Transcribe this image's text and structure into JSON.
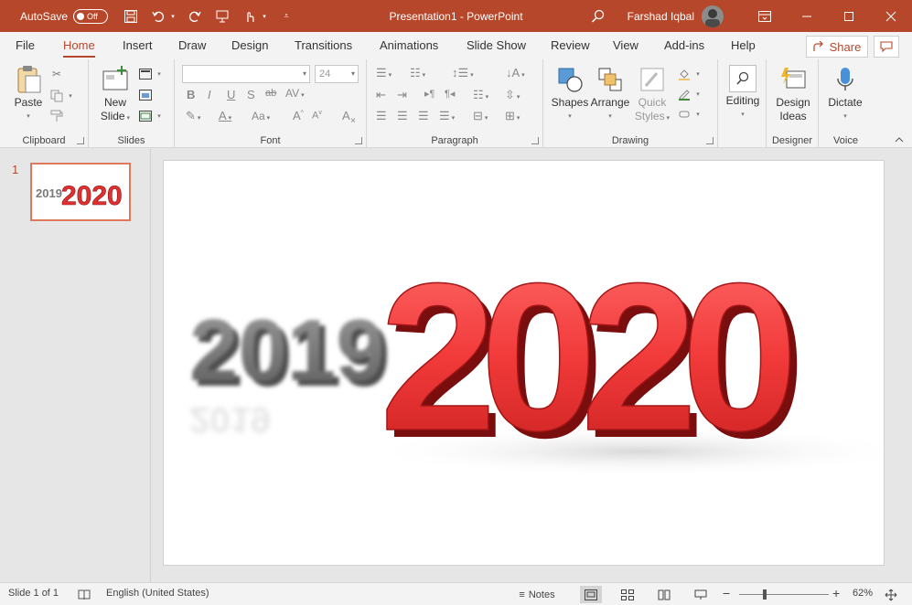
{
  "titlebar": {
    "autosave_label": "AutoSave",
    "autosave_state": "Off",
    "doc_title": "Presentation1  -  PowerPoint",
    "user_name": "Farshad Iqbal",
    "accent": "#b7472a"
  },
  "tabs": [
    {
      "label": "File"
    },
    {
      "label": "Home",
      "active": true
    },
    {
      "label": "Insert"
    },
    {
      "label": "Draw"
    },
    {
      "label": "Design"
    },
    {
      "label": "Transitions"
    },
    {
      "label": "Animations"
    },
    {
      "label": "Slide Show"
    },
    {
      "label": "Review"
    },
    {
      "label": "View"
    },
    {
      "label": "Add-ins"
    },
    {
      "label": "Help"
    }
  ],
  "share_label": "Share",
  "ribbon": {
    "clipboard": {
      "label": "Clipboard",
      "paste": "Paste"
    },
    "slides": {
      "label": "Slides",
      "new_slide_line1": "New",
      "new_slide_line2": "Slide"
    },
    "font": {
      "label": "Font",
      "font_name": "",
      "font_size": "24"
    },
    "paragraph": {
      "label": "Paragraph"
    },
    "drawing": {
      "label": "Drawing",
      "shapes": "Shapes",
      "arrange": "Arrange",
      "quick_styles_line1": "Quick",
      "quick_styles_line2": "Styles"
    },
    "editing": {
      "label": "Editing"
    },
    "designer": {
      "label": "Designer",
      "design_ideas_line1": "Design",
      "design_ideas_line2": "Ideas"
    },
    "voice": {
      "label": "Voice",
      "dictate": "Dictate"
    }
  },
  "slide_panel": {
    "slide_number": "1"
  },
  "slide": {
    "old_year": "2019",
    "new_year": "2020"
  },
  "statusbar": {
    "slide_info": "Slide 1 of 1",
    "language": "English (United States)",
    "notes": "Notes",
    "zoom": "62%"
  }
}
